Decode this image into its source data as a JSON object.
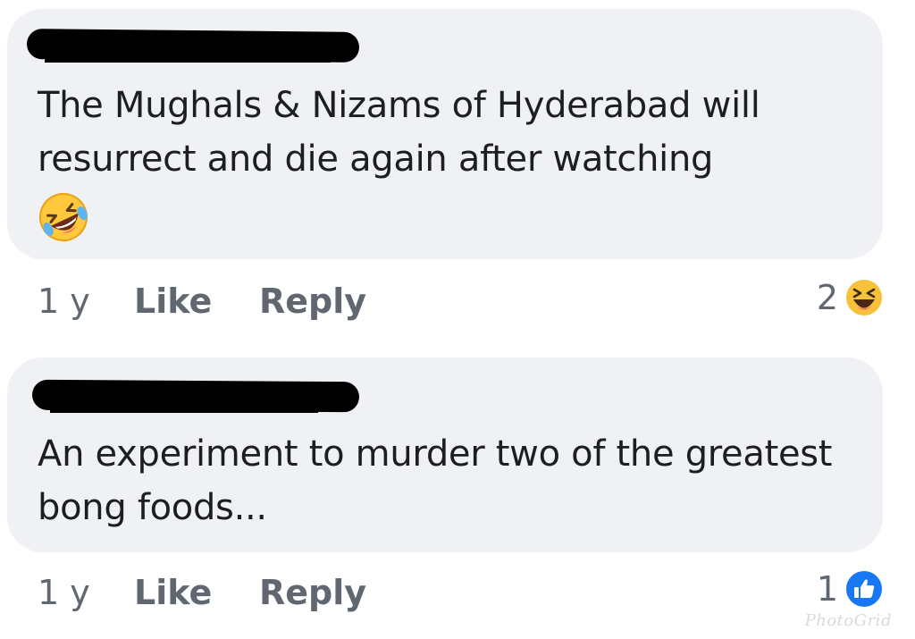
{
  "comments": [
    {
      "author_redacted": true,
      "text": "The Mughals & Nizams of Hyderabad will resurrect and die again after watching",
      "inline_emoji": "rolling-on-floor-laughing",
      "time": "1 y",
      "like_label": "Like",
      "reply_label": "Reply",
      "reaction_count": "2",
      "reaction_icon": "haha-reaction"
    },
    {
      "author_redacted": true,
      "text": "An experiment to murder two of the greatest bong foods...",
      "time": "1 y",
      "like_label": "Like",
      "reply_label": "Reply",
      "reaction_count": "1",
      "reaction_icon": "like-reaction"
    }
  ],
  "watermark": "PhotoGrid",
  "colors": {
    "bubble": "#f0f1f5",
    "meta_text": "#606770",
    "like_blue": "#1877f2",
    "haha_yellow": "#f7b125"
  }
}
